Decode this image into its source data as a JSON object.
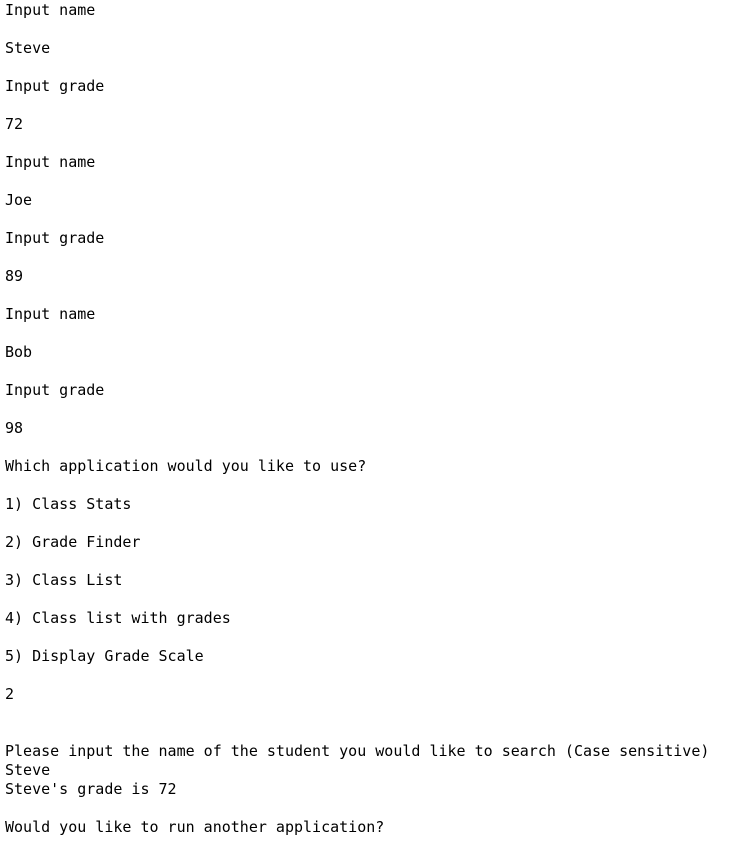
{
  "console": {
    "lines": [
      "Input name",
      "Steve",
      "Input grade",
      "72",
      "Input name",
      "Joe",
      "Input grade",
      "89",
      "Input name",
      "Bob",
      "Input grade",
      "98",
      "Which application would you like to use?",
      "1) Class Stats",
      "2) Grade Finder",
      "3) Class List",
      "4) Class list with grades",
      "5) Display Grade Scale",
      "2",
      "Please input the name of the student you would like to search (Case sensitive)",
      "Steve",
      "Steve's grade is 72",
      "Would you like to run another application?"
    ]
  }
}
